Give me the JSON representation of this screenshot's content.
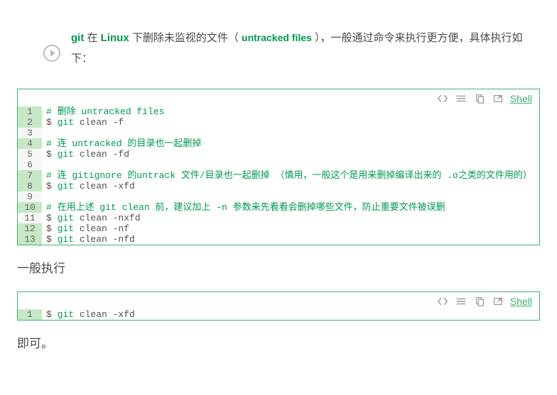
{
  "intro": {
    "git": "git",
    "t1": " 在 ",
    "linux": "Linux",
    "t2": " 下删除未监视的文件（ ",
    "uf": "untracked files",
    "t3": " ），一般通过命令来执行更方便，具体执行如下："
  },
  "code1": {
    "lang": "Shell",
    "lines": [
      {
        "n": "1",
        "hl": true,
        "type": "comment",
        "text": "# 删除 untracked files"
      },
      {
        "n": "2",
        "hl": true,
        "type": "cmd",
        "text": "$ git clean -f"
      },
      {
        "n": "3",
        "hl": false,
        "type": "plain",
        "text": ""
      },
      {
        "n": "4",
        "hl": true,
        "type": "comment",
        "text": "# 连 untracked 的目录也一起删掉"
      },
      {
        "n": "5",
        "hl": false,
        "type": "cmd",
        "text": "$ git clean -fd"
      },
      {
        "n": "6",
        "hl": false,
        "type": "plain",
        "text": ""
      },
      {
        "n": "7",
        "hl": true,
        "type": "comment",
        "text": "# 连 gitignore 的untrack 文件/目录也一起删掉 （慎用，一般这个是用来删掉编译出来的 .o之类的文件用的）"
      },
      {
        "n": "8",
        "hl": true,
        "type": "cmd",
        "text": "$ git clean -xfd"
      },
      {
        "n": "9",
        "hl": false,
        "type": "plain",
        "text": ""
      },
      {
        "n": "10",
        "hl": true,
        "type": "comment",
        "text": "# 在用上述 git clean 前，建议加上 -n 参数来先看看会删掉哪些文件，防止重要文件被误删"
      },
      {
        "n": "11",
        "hl": false,
        "type": "cmd",
        "text": "$ git clean -nxfd"
      },
      {
        "n": "12",
        "hl": true,
        "type": "cmd",
        "text": "$ git clean -nf"
      },
      {
        "n": "13",
        "hl": true,
        "type": "cmd",
        "text": "$ git clean -nfd"
      }
    ]
  },
  "mid_text": "一般执行",
  "code2": {
    "lang": "Shell",
    "lines": [
      {
        "n": "1",
        "hl": true,
        "type": "cmd",
        "text": "$ git clean -xfd"
      }
    ]
  },
  "end_text": "即可。"
}
